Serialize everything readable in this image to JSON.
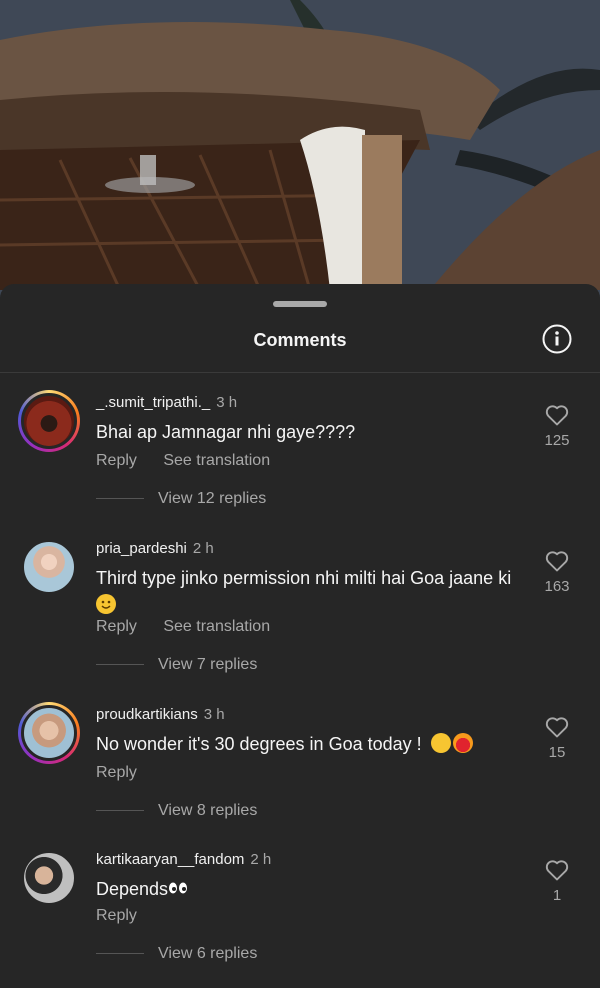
{
  "sheet": {
    "title": "Comments"
  },
  "comments": [
    {
      "username": "_.sumit_tripathi._",
      "time": "3 h",
      "text": "Bhai ap Jamnagar nhi gaye????",
      "reply": "Reply",
      "translate": "See translation",
      "view_replies": "View 12 replies",
      "likes": "125"
    },
    {
      "username": "pria_pardeshi",
      "time": "2 h",
      "text": "Third type jinko permission nhi milti hai Goa jaane ki",
      "reply": "Reply",
      "translate": "See translation",
      "view_replies": "View 7 replies",
      "likes": "163"
    },
    {
      "username": "proudkartikians",
      "time": "3 h",
      "text": "No wonder it's 30 degrees in Goa today !",
      "reply": "Reply",
      "view_replies": "View 8 replies",
      "likes": "15"
    },
    {
      "username": "kartikaaryan__fandom",
      "time": "2 h",
      "text": "Depends",
      "reply": "Reply",
      "view_replies": "View 6 replies",
      "likes": "1"
    }
  ]
}
